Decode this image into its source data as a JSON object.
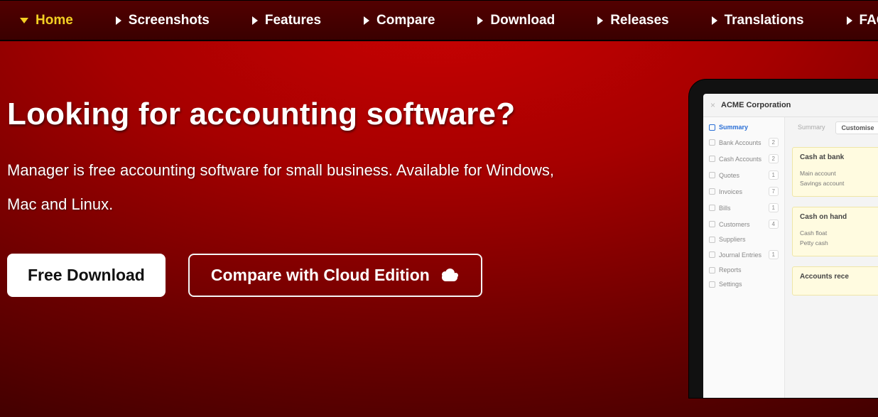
{
  "nav": {
    "items": [
      {
        "label": "Home",
        "active": true
      },
      {
        "label": "Screenshots",
        "active": false
      },
      {
        "label": "Features",
        "active": false
      },
      {
        "label": "Compare",
        "active": false
      },
      {
        "label": "Download",
        "active": false
      },
      {
        "label": "Releases",
        "active": false
      },
      {
        "label": "Translations",
        "active": false
      },
      {
        "label": "FAQ",
        "active": false
      }
    ]
  },
  "hero": {
    "title": "Looking for accounting software?",
    "subtitle": "Manager is free accounting software for small business. Available for Windows, Mac and Linux.",
    "primary_cta": "Free Download",
    "secondary_cta": "Compare with Cloud Edition"
  },
  "preview": {
    "business_name": "ACME Corporation",
    "sidebar": [
      {
        "label": "Summary",
        "badge": "",
        "active": true
      },
      {
        "label": "Bank Accounts",
        "badge": "2",
        "active": false
      },
      {
        "label": "Cash Accounts",
        "badge": "2",
        "active": false
      },
      {
        "label": "Quotes",
        "badge": "1",
        "active": false
      },
      {
        "label": "Invoices",
        "badge": "7",
        "active": false
      },
      {
        "label": "Bills",
        "badge": "1",
        "active": false
      },
      {
        "label": "Customers",
        "badge": "4",
        "active": false
      },
      {
        "label": "Suppliers",
        "badge": "",
        "active": false
      },
      {
        "label": "Journal Entries",
        "badge": "1",
        "active": false
      },
      {
        "label": "Reports",
        "badge": "",
        "active": false
      },
      {
        "label": "Settings",
        "badge": "",
        "active": false
      }
    ],
    "tabs": {
      "summary": "Summary",
      "customise": "Customise"
    },
    "cards": [
      {
        "title": "Cash at bank",
        "lines": [
          "Main account",
          "Savings account"
        ]
      },
      {
        "title": "Cash on hand",
        "lines": [
          "Cash float",
          "Petty cash"
        ]
      },
      {
        "title": "Accounts rece",
        "lines": []
      }
    ]
  }
}
